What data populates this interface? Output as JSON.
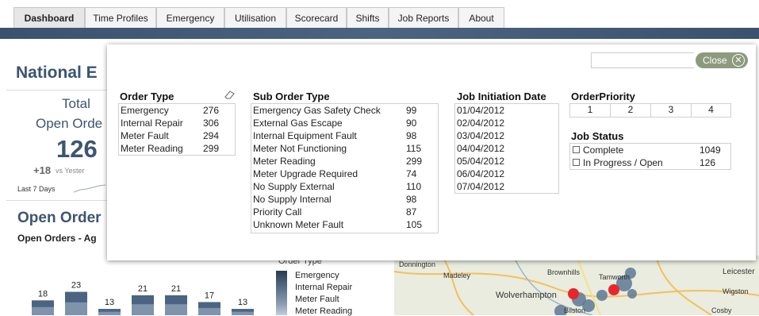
{
  "tabs": [
    "Dashboard",
    "Time Profiles",
    "Emergency",
    "Utilisation",
    "Scorecard",
    "Shifts",
    "Job Reports",
    "About"
  ],
  "active_tab": "Dashboard",
  "background": {
    "title": "National E",
    "total_label": "Total",
    "open_label": "Open Orde",
    "big_number": "126",
    "delta": "+18",
    "delta_sub": "vs Yester",
    "last7": "Last 7 Days",
    "open_orders_heading": "Open Order",
    "open_orders_sub": "Open Orders - Ag",
    "bar_values": [
      "18",
      "23",
      "13",
      "21",
      "21",
      "17",
      "13"
    ],
    "legend_title": "Order Type",
    "legend_items": [
      "Emergency",
      "Internal Repair",
      "Meter Fault",
      "Meter Reading"
    ],
    "map_labels": [
      "Donnington",
      "Madeley",
      "Brownhills",
      "Tamworth",
      "Wolverhampton",
      "Leicester",
      "Wigston",
      "Cosby",
      "Bilston"
    ]
  },
  "popup": {
    "close_label": "Close",
    "order_type": {
      "title": "Order Type",
      "rows": [
        {
          "name": "Emergency",
          "count": "276"
        },
        {
          "name": "Internal Repair",
          "count": "306"
        },
        {
          "name": "Meter Fault",
          "count": "294"
        },
        {
          "name": "Meter Reading",
          "count": "299"
        }
      ]
    },
    "sub_order_type": {
      "title": "Sub Order Type",
      "rows": [
        {
          "name": "Emergency Gas Safety Check",
          "count": "99"
        },
        {
          "name": "External Gas Escape",
          "count": "90"
        },
        {
          "name": "Internal Equipment Fault",
          "count": "98"
        },
        {
          "name": "Meter Not Functioning",
          "count": "115"
        },
        {
          "name": "Meter Reading",
          "count": "299"
        },
        {
          "name": "Meter Upgrade Required",
          "count": "74"
        },
        {
          "name": "No Supply External",
          "count": "110"
        },
        {
          "name": "No Supply Internal",
          "count": "98"
        },
        {
          "name": "Priority Call",
          "count": "87"
        },
        {
          "name": "Unknown Meter Fault",
          "count": "105"
        }
      ]
    },
    "job_initiation": {
      "title": "Job Initiation Date",
      "dates": [
        "01/04/2012",
        "02/04/2012",
        "03/04/2012",
        "04/04/2012",
        "05/04/2012",
        "06/04/2012",
        "07/04/2012"
      ]
    },
    "order_priority": {
      "title": "OrderPriority",
      "values": [
        "1",
        "2",
        "3",
        "4"
      ]
    },
    "job_status": {
      "title": "Job Status",
      "rows": [
        {
          "name": "Complete",
          "count": "1049"
        },
        {
          "name": "In Progress / Open",
          "count": "126"
        }
      ]
    }
  },
  "colors": {
    "header_bar": "#3d5470",
    "title_blue": "#3c5571",
    "close_button": "#8d9a7e",
    "map_marker": "#e8262c"
  }
}
